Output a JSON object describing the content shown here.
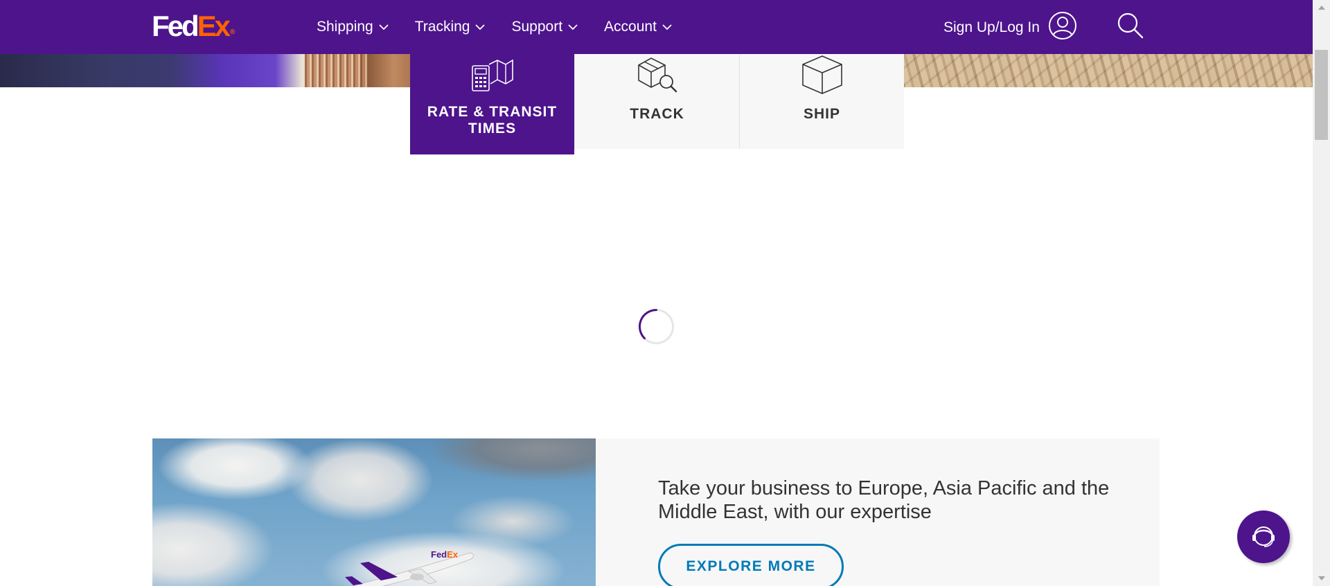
{
  "header": {
    "logo": {
      "fed": "Fed",
      "ex": "Ex",
      "reg": "®"
    },
    "nav": [
      {
        "label": "Shipping"
      },
      {
        "label": "Tracking"
      },
      {
        "label": "Support"
      },
      {
        "label": "Account"
      }
    ],
    "signin_label": "Sign Up/Log In"
  },
  "tiles": [
    {
      "label": "RATE & TRANSIT TIMES",
      "icon": "rate-calculator-icon",
      "active": true
    },
    {
      "label": "TRACK",
      "icon": "track-package-icon",
      "active": false
    },
    {
      "label": "SHIP",
      "icon": "ship-box-icon",
      "active": false
    }
  ],
  "promo": {
    "headline": "Take your business to Europe, Asia Pacific and the Middle East, with our expertise",
    "cta_label": "EXPLORE MORE"
  },
  "colors": {
    "brand_purple": "#4d148c",
    "brand_orange": "#ff6200",
    "link_blue": "#007ab7"
  }
}
